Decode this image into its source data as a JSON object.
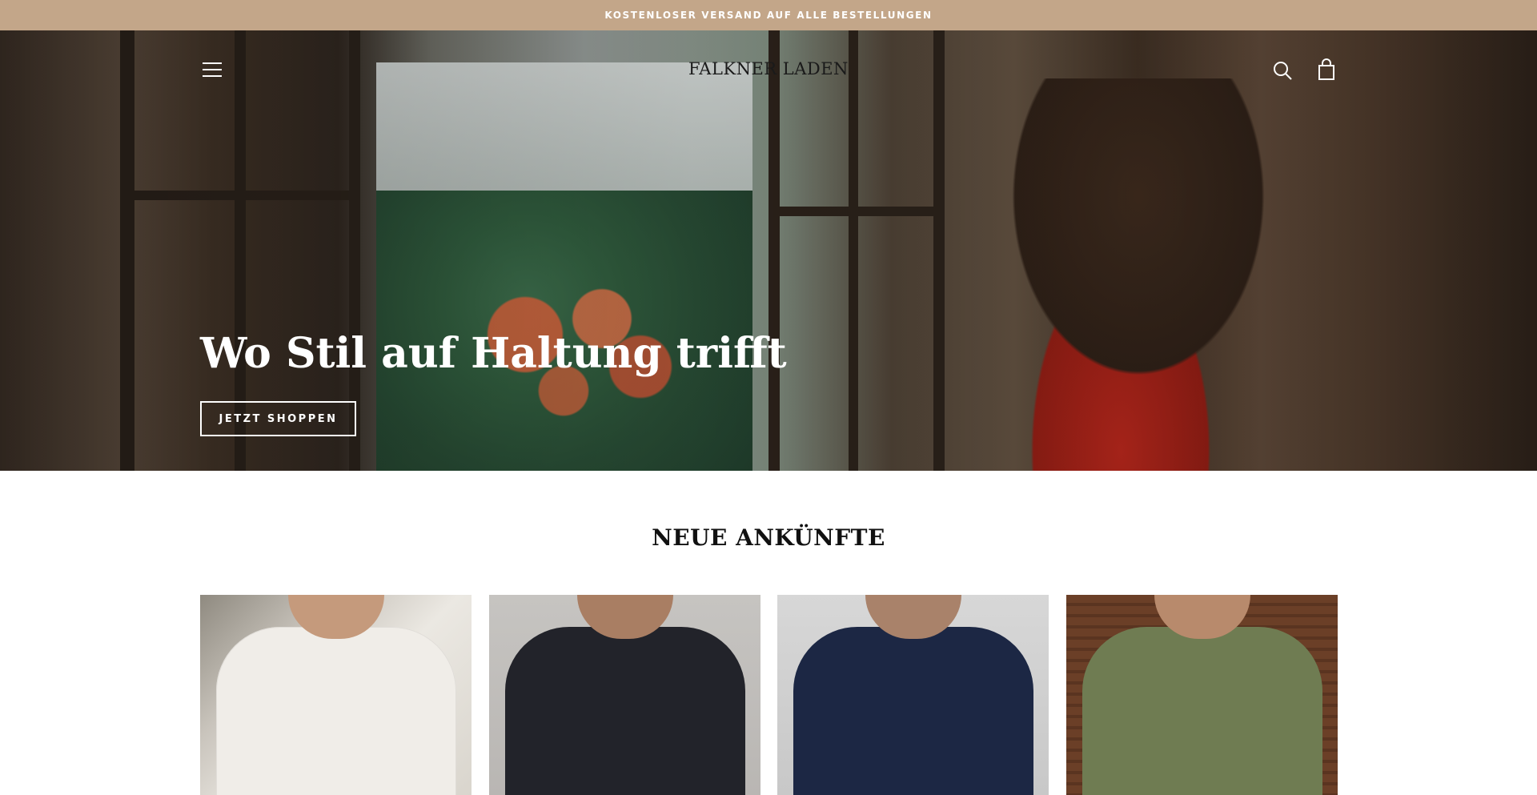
{
  "announcement": {
    "text": "KOSTENLOSER VERSAND AUF ALLE BESTELLUNGEN"
  },
  "header": {
    "logo": "FALKNER LADEN",
    "menu_icon": "hamburger-menu-icon",
    "search_icon": "search-icon",
    "cart_icon": "shopping-bag-icon"
  },
  "hero": {
    "title": "Wo Stil auf Haltung trifft",
    "cta_label": "JETZT SHOPPEN"
  },
  "new_arrivals": {
    "title": "NEUE ANKÜNFTE",
    "products": [
      {
        "image": "cream-ribbed-polo-shirt"
      },
      {
        "image": "black-zip-polo-shirt"
      },
      {
        "image": "navy-knit-polo-shirt"
      },
      {
        "image": "olive-green-polo-shirt"
      }
    ]
  },
  "colors": {
    "announcement_bg": "#c3a689",
    "text_dark": "#1c1c1c",
    "white": "#ffffff"
  }
}
